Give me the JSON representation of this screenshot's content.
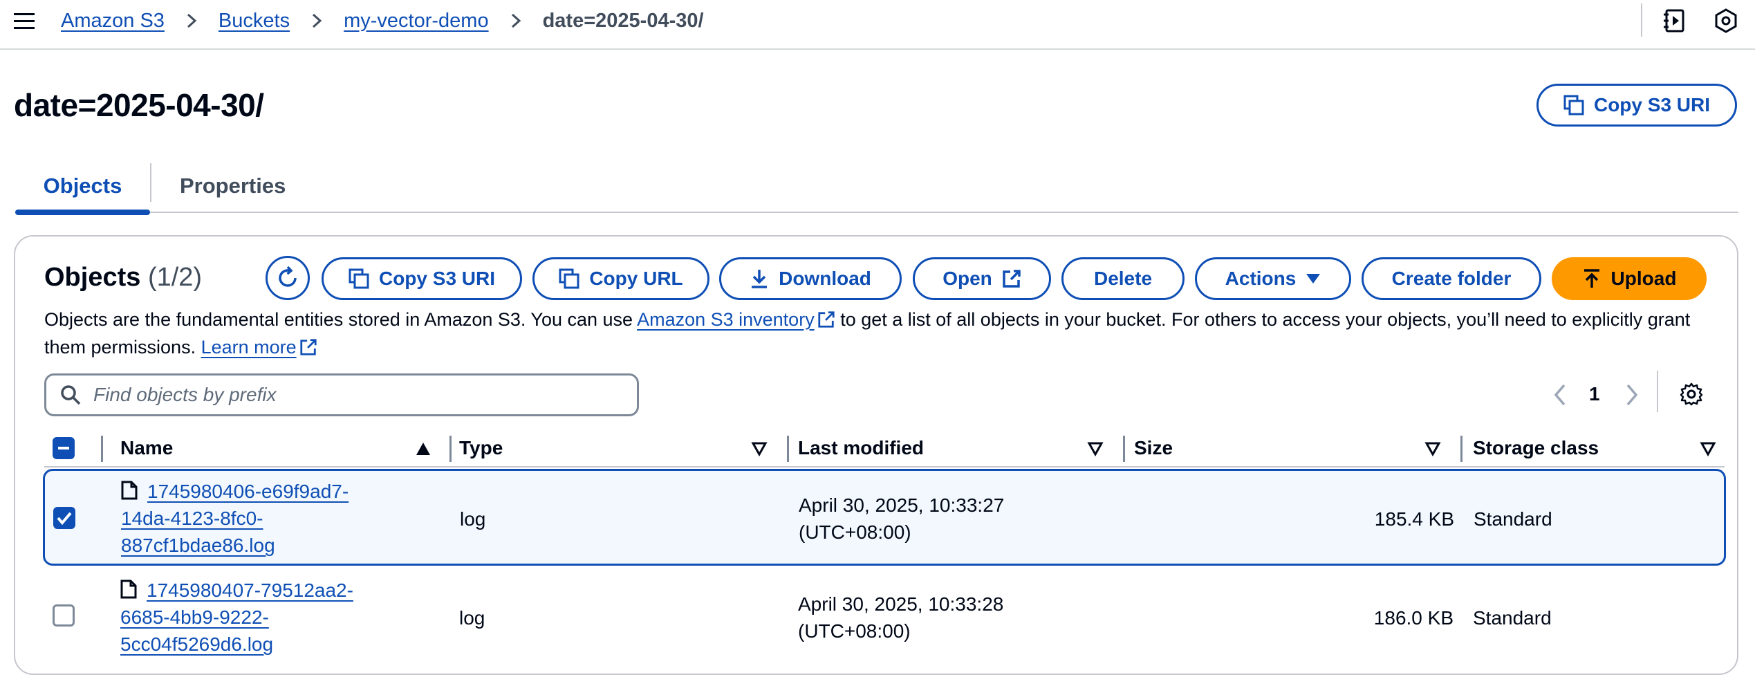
{
  "breadcrumb": {
    "items": [
      "Amazon S3",
      "Buckets",
      "my-vector-demo"
    ],
    "current": "date=2025-04-30/"
  },
  "header": {
    "title": "date=2025-04-30/",
    "copy_uri_label": "Copy S3 URI"
  },
  "tabs": [
    {
      "label": "Objects",
      "active": true
    },
    {
      "label": "Properties",
      "active": false
    }
  ],
  "objects": {
    "heading": "Objects",
    "count": "(1/2)",
    "buttons": {
      "copy_uri": "Copy S3 URI",
      "copy_url": "Copy URL",
      "download": "Download",
      "open": "Open",
      "delete": "Delete",
      "actions": "Actions",
      "create_folder": "Create folder",
      "upload": "Upload"
    },
    "description": {
      "part1": "Objects are the fundamental entities stored in Amazon S3. You can use ",
      "inventory_link": "Amazon S3 inventory",
      "part2": " to get a list of all objects in your bucket. For others to access your objects, you’ll need to explicitly grant them permissions. ",
      "learn_more": "Learn more"
    },
    "search": {
      "placeholder": "Find objects by prefix",
      "value": ""
    },
    "pagination": {
      "page": "1"
    }
  },
  "table": {
    "columns": [
      "Name",
      "Type",
      "Last modified",
      "Size",
      "Storage class"
    ],
    "rows": [
      {
        "selected": true,
        "name_lines": [
          "1745980406-e69f9ad7-",
          "14da-4123-8fc0-",
          "887cf1bdae86.log"
        ],
        "type": "log",
        "modified_lines": [
          "April 30, 2025, 10:33:27",
          "(UTC+08:00)"
        ],
        "size": "185.4 KB",
        "storage_class": "Standard"
      },
      {
        "selected": false,
        "name_lines": [
          "1745980407-79512aa2-",
          "6685-4bb9-9222-",
          "5cc04f5269d6.log"
        ],
        "type": "log",
        "modified_lines": [
          "April 30, 2025, 10:33:28",
          "(UTC+08:00)"
        ],
        "size": "186.0 KB",
        "storage_class": "Standard"
      }
    ]
  },
  "colors": {
    "link": "#0f4fb5",
    "primary": "#ff9900",
    "selected_row": "#f2f8fd"
  }
}
